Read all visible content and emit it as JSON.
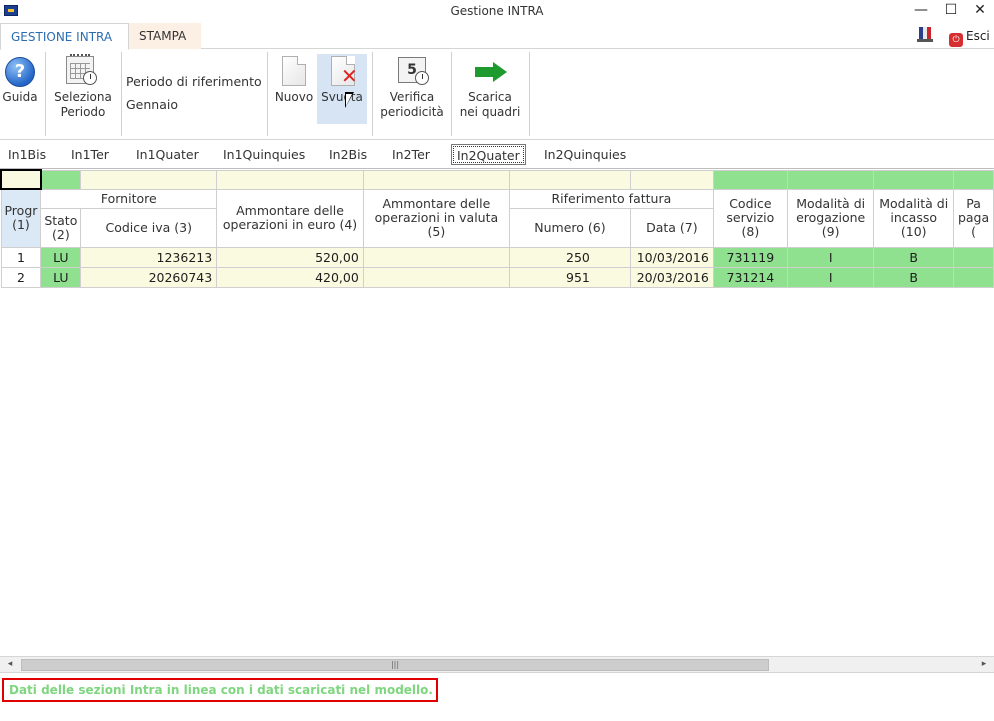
{
  "window": {
    "title": "Gestione INTRA",
    "minimize": "—",
    "maximize": "☐",
    "close": "✕"
  },
  "ribbon_tabs": {
    "gestione": "GESTIONE INTRA",
    "stampa": "STAMPA",
    "esci": "Esci"
  },
  "ribbon": {
    "guida": "Guida",
    "seleziona": [
      "Seleziona",
      "Periodo"
    ],
    "periodo_label": "Periodo di riferimento",
    "periodo_value": "Gennaio",
    "nuovo": "Nuovo",
    "svuota": "Svuota",
    "verifica": [
      "Verifica",
      "periodicità"
    ],
    "verifica_icon_digit": "5",
    "scarica": [
      "Scarica",
      "nei quadri"
    ]
  },
  "section_tabs": [
    "In1Bis",
    "In1Ter",
    "In1Quater",
    "In1Quinquies",
    "In2Bis",
    "In2Ter",
    "In2Quater",
    "In2Quinquies"
  ],
  "active_section_tab": "In2Quater",
  "table": {
    "groups": {
      "fornitore": "Fornitore",
      "riferimento": "Riferimento fattura"
    },
    "headers": {
      "progr": [
        "Progr",
        "(1)"
      ],
      "stato": [
        "Stato",
        "(2)"
      ],
      "codice_iva": "Codice iva (3)",
      "ammontare_euro": [
        "Ammontare delle",
        "operazioni in euro (4)"
      ],
      "ammontare_valuta": [
        "Ammontare delle",
        "operazioni in valuta",
        "(5)"
      ],
      "numero": "Numero (6)",
      "data": "Data (7)",
      "codice_servizio": [
        "Codice",
        "servizio",
        "(8)"
      ],
      "modalita_erogazione": [
        "Modalità di",
        "erogazione",
        "(9)"
      ],
      "modalita_incasso": [
        "Modalità di",
        "incasso",
        "(10)"
      ],
      "paese_pagamento": [
        "Pa",
        "paga",
        "("
      ]
    },
    "rows": [
      {
        "progr": "1",
        "stato": "LU",
        "codice_iva": "1236213",
        "ammontare_euro": "520,00",
        "ammontare_valuta": "",
        "numero": "250",
        "data": "10/03/2016",
        "codice_servizio": "731119",
        "erogazione": "I",
        "incasso": "B",
        "paese": ""
      },
      {
        "progr": "2",
        "stato": "LU",
        "codice_iva": "20260743",
        "ammontare_euro": "420,00",
        "ammontare_valuta": "",
        "numero": "951",
        "data": "20/03/2016",
        "codice_servizio": "731214",
        "erogazione": "I",
        "incasso": "B",
        "paese": ""
      }
    ]
  },
  "status_message": "Dati delle sezioni Intra in linea con i dati scaricati nel modello.",
  "colors": {
    "accent_blue": "#2b6cb0",
    "green_cell": "#8fe08f",
    "yellow_cell": "#fafae0",
    "status_border": "#e00000",
    "status_text": "#7ed67e"
  }
}
